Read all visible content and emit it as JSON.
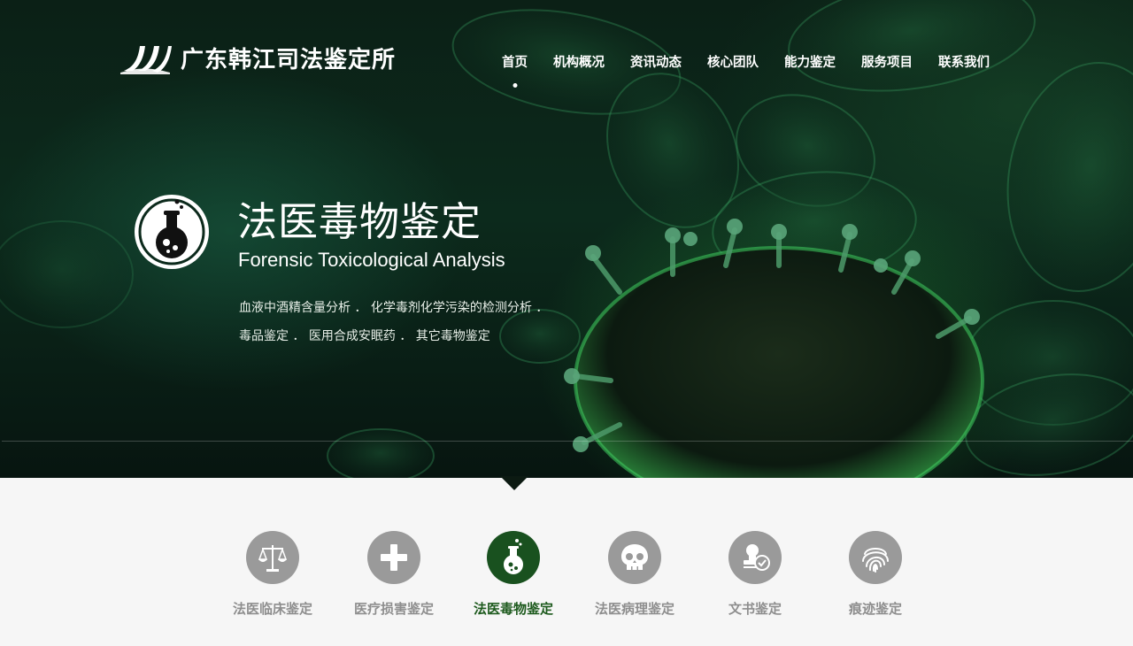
{
  "brand": {
    "name": "广东韩江司法鉴定所"
  },
  "nav": {
    "items": [
      {
        "label": "首页",
        "active": true
      },
      {
        "label": "机构概况"
      },
      {
        "label": "资讯动态"
      },
      {
        "label": "核心团队"
      },
      {
        "label": "能力鉴定"
      },
      {
        "label": "服务项目"
      },
      {
        "label": "联系我们"
      }
    ]
  },
  "hero": {
    "icon": "flask-icon",
    "title": "法医毒物鉴定",
    "subtitle": "Forensic Toxicological Analysis",
    "line1": "血液中酒精含量分析 ． 化学毒剂化学污染的检测分析 ．",
    "line2": "毒品鉴定 ． 医用合成安眠药 ． 其它毒物鉴定"
  },
  "services": [
    {
      "label": "法医临床鉴定",
      "icon": "scales-icon"
    },
    {
      "label": "医疗损害鉴定",
      "icon": "medical-cross-icon"
    },
    {
      "label": "法医毒物鉴定",
      "icon": "flask-icon",
      "active": true
    },
    {
      "label": "法医病理鉴定",
      "icon": "skull-icon"
    },
    {
      "label": "文书鉴定",
      "icon": "document-verify-icon"
    },
    {
      "label": "痕迹鉴定",
      "icon": "fingerprint-icon"
    }
  ],
  "colors": {
    "accent": "#19511f",
    "inactive_icon": "#9a9a9a",
    "hero_bg": "#0c2a1c",
    "page_bg": "#f6f6f6"
  }
}
